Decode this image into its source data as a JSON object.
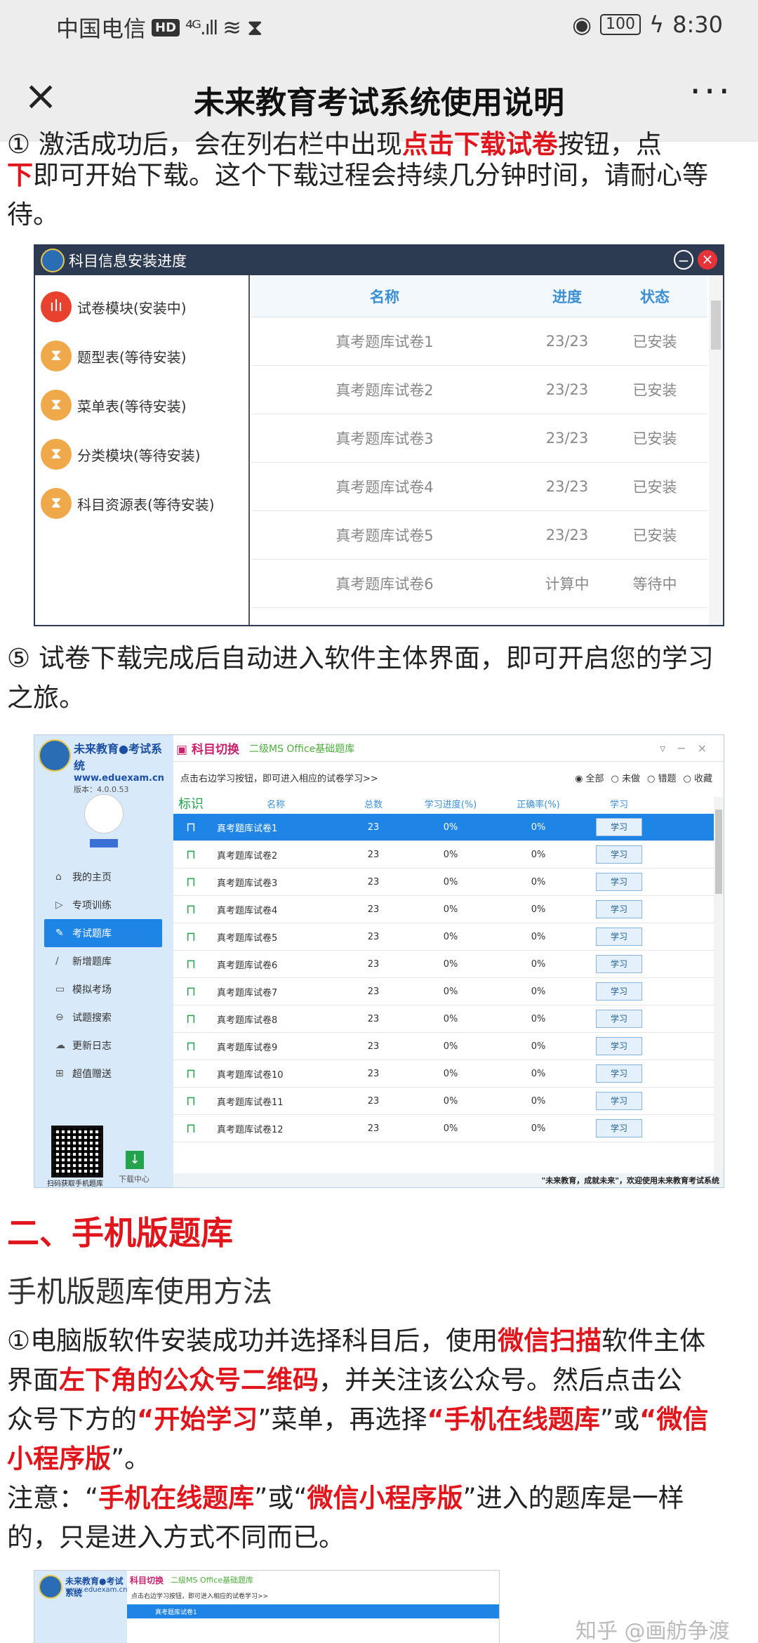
{
  "status_bar": {
    "carrier": "中国电信",
    "hd": "HD",
    "signal": "⁴ᴳ.ıll",
    "battery": "100",
    "time": "8:30"
  },
  "title_bar": {
    "title": "未来教育考试系统使用说明"
  },
  "intro": {
    "line1_prefix": "① 激活成功后，会在列右栏中出现",
    "line1_red1": "点击下载试卷",
    "line1_mid": "按钮，点",
    "line2_red": "下",
    "line2_rest": "即可开始下载。这个下载过程会持续几分钟时间，请耐心等",
    "line3": "待。"
  },
  "install_panel": {
    "title": "科目信息安装进度",
    "modules": [
      {
        "label": "试卷模块(安装中)",
        "icon": "audio-bars-icon"
      },
      {
        "label": "题型表(等待安装)",
        "icon": "hourglass-icon"
      },
      {
        "label": "菜单表(等待安装)",
        "icon": "hourglass-icon"
      },
      {
        "label": "分类模块(等待安装)",
        "icon": "hourglass-icon"
      },
      {
        "label": "科目资源表(等待安装)",
        "icon": "hourglass-icon"
      }
    ],
    "columns": {
      "name": "名称",
      "progress": "进度",
      "status": "状态"
    },
    "rows": [
      {
        "name": "真考题库试卷1",
        "progress": "23/23",
        "status": "已安装"
      },
      {
        "name": "真考题库试卷2",
        "progress": "23/23",
        "status": "已安装"
      },
      {
        "name": "真考题库试卷3",
        "progress": "23/23",
        "status": "已安装"
      },
      {
        "name": "真考题库试卷4",
        "progress": "23/23",
        "status": "已安装"
      },
      {
        "name": "真考题库试卷5",
        "progress": "23/23",
        "status": "已安装"
      },
      {
        "name": "真考题库试卷6",
        "progress": "计算中",
        "status": "等待中"
      }
    ]
  },
  "step5": {
    "line1": "⑤ 试卷下载完成后自动进入软件主体界面，即可开启您的学习",
    "line2": "之旅。"
  },
  "main_panel": {
    "brand": "未来教育●考试系统",
    "site": "www.eduexam.cn",
    "version": "版本：4.0.0.53",
    "nav": [
      {
        "label": "我的主页",
        "icon": "home-icon",
        "glyph": "⌂"
      },
      {
        "label": "专项训练",
        "icon": "play-icon",
        "glyph": "▷"
      },
      {
        "label": "考试题库",
        "icon": "edit-icon",
        "glyph": "✎"
      },
      {
        "label": "新增题库",
        "icon": "pen-icon",
        "glyph": "∕"
      },
      {
        "label": "模拟考场",
        "icon": "monitor-icon",
        "glyph": "▭"
      },
      {
        "label": "试题搜索",
        "icon": "search-icon",
        "glyph": "⊖"
      },
      {
        "label": "更新日志",
        "icon": "cloud-icon",
        "glyph": "☁"
      },
      {
        "label": "超值赠送",
        "icon": "gift-icon",
        "glyph": "⊞"
      }
    ],
    "qr_label": "扫码获取手机题库",
    "download_label": "下载中心",
    "switch_label": "科目切换",
    "subject": "二级MS Office基础题库",
    "hint": "点击右边学习按钮，即可进入相应的试卷学习>>",
    "filters": [
      "◉ 全部",
      "○ 未做",
      "○ 错题",
      "○ 收藏"
    ],
    "columns": {
      "flag": "标识",
      "name": "名称",
      "count": "总数",
      "progress": "学习进度(%)",
      "accuracy": "正确率(%)",
      "study": "学习"
    },
    "rows": [
      {
        "name": "真考题库试卷1",
        "count": "23",
        "progress": "0%",
        "accuracy": "0%",
        "btn": "学习"
      },
      {
        "name": "真考题库试卷2",
        "count": "23",
        "progress": "0%",
        "accuracy": "0%",
        "btn": "学习"
      },
      {
        "name": "真考题库试卷3",
        "count": "23",
        "progress": "0%",
        "accuracy": "0%",
        "btn": "学习"
      },
      {
        "name": "真考题库试卷4",
        "count": "23",
        "progress": "0%",
        "accuracy": "0%",
        "btn": "学习"
      },
      {
        "name": "真考题库试卷5",
        "count": "23",
        "progress": "0%",
        "accuracy": "0%",
        "btn": "学习"
      },
      {
        "name": "真考题库试卷6",
        "count": "23",
        "progress": "0%",
        "accuracy": "0%",
        "btn": "学习"
      },
      {
        "name": "真考题库试卷7",
        "count": "23",
        "progress": "0%",
        "accuracy": "0%",
        "btn": "学习"
      },
      {
        "name": "真考题库试卷8",
        "count": "23",
        "progress": "0%",
        "accuracy": "0%",
        "btn": "学习"
      },
      {
        "name": "真考题库试卷9",
        "count": "23",
        "progress": "0%",
        "accuracy": "0%",
        "btn": "学习"
      },
      {
        "name": "真考题库试卷10",
        "count": "23",
        "progress": "0%",
        "accuracy": "0%",
        "btn": "学习"
      },
      {
        "name": "真考题库试卷11",
        "count": "23",
        "progress": "0%",
        "accuracy": "0%",
        "btn": "学习"
      },
      {
        "name": "真考题库试卷12",
        "count": "23",
        "progress": "0%",
        "accuracy": "0%",
        "btn": "学习"
      }
    ],
    "footer": "\"未来教育，成就未来\"，欢迎使用未来教育考试系统"
  },
  "section2": {
    "heading": "二、手机版题库",
    "subheading": "手机版题库使用方法"
  },
  "step1": {
    "p1": "①电脑版软件安装成功并选择科目后，使用",
    "r1": "微信扫描",
    "p2": "软件主体",
    "p3": "界面",
    "r2": "左下角的公众号二维码",
    "p4": "，并关注该公众号。然后点击公",
    "p5": "众号下方的",
    "r3": "“开始学习",
    "p6": "”菜单，再选择",
    "r4": "“手机在线题库",
    "p7": "”或",
    "r5": "“微信",
    "r6": "小程序版",
    "p8": "”。"
  },
  "note": {
    "p1": "注意：“",
    "r1": "手机在线题库",
    "p2": "”或“",
    "r2": "微信小程序版",
    "p3": "”进入的题库是一样",
    "p4": "的，只是进入方式不同而已。"
  },
  "thumb": {
    "brand": "未来教育●考试系统",
    "site": "www.eduexam.cn",
    "switch_label": "科目切换",
    "subject": "二级MS Office基础题库",
    "hint": "点击右边学习按钮，即可进入相应的试卷学习>>",
    "row1": "真考题库试卷1"
  },
  "watermark": "知乎 @画舫争渡"
}
